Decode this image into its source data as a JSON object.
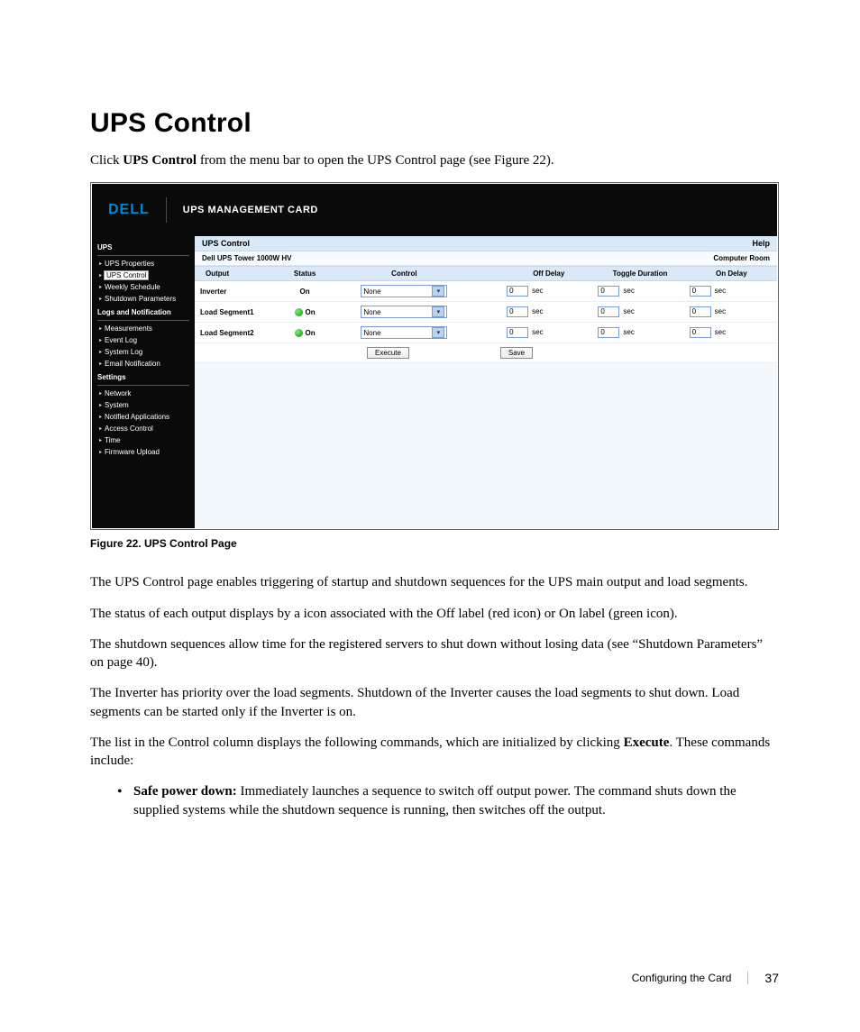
{
  "heading": "UPS Control",
  "intro_prefix": "Click ",
  "intro_bold": "UPS Control",
  "intro_suffix": " from the menu bar to open the UPS Control page (see Figure 22).",
  "figure_caption": "Figure 22. UPS Control Page",
  "shot": {
    "logo": "DELL",
    "card_name": "UPS MANAGEMENT CARD",
    "sidebar": {
      "sections": [
        {
          "title": "UPS",
          "items": [
            {
              "label": "UPS Properties",
              "selected": false
            },
            {
              "label": "UPS Control",
              "selected": true
            },
            {
              "label": "Weekly Schedule",
              "selected": false
            },
            {
              "label": "Shutdown Parameters",
              "selected": false
            }
          ]
        },
        {
          "title": "Logs and Notification",
          "items": [
            {
              "label": "Measurements"
            },
            {
              "label": "Event Log"
            },
            {
              "label": "System Log"
            },
            {
              "label": "Email Notification"
            }
          ]
        },
        {
          "title": "Settings",
          "items": [
            {
              "label": "Network"
            },
            {
              "label": "System"
            },
            {
              "label": "Notified Applications"
            },
            {
              "label": "Access Control"
            },
            {
              "label": "Time"
            },
            {
              "label": "Firmware Upload"
            }
          ]
        }
      ]
    },
    "titlebar": {
      "left": "UPS Control",
      "right": "Help"
    },
    "hostbar": {
      "left": "Dell UPS Tower 1000W HV",
      "right": "Computer Room"
    },
    "table": {
      "headers": [
        "Output",
        "Status",
        "Control",
        "Off Delay",
        "Toggle Duration",
        "On Delay"
      ],
      "unit": "sec",
      "rows": [
        {
          "output": "Inverter",
          "status_on": true,
          "status_label": "On",
          "control": "None",
          "off": "0",
          "toggle": "0",
          "on": "0",
          "show_dot": false
        },
        {
          "output": "Load Segment1",
          "status_on": true,
          "status_label": "On",
          "control": "None",
          "off": "0",
          "toggle": "0",
          "on": "0",
          "show_dot": true
        },
        {
          "output": "Load Segment2",
          "status_on": true,
          "status_label": "On",
          "control": "None",
          "off": "0",
          "toggle": "0",
          "on": "0",
          "show_dot": true
        }
      ],
      "execute_label": "Execute",
      "save_label": "Save"
    }
  },
  "paragraphs": {
    "p1": "The UPS Control page enables triggering of startup and shutdown sequences for the UPS main output and load segments.",
    "p2": "The status of each output displays by a icon associated with the Off label (red icon) or On label (green icon).",
    "p3": "The shutdown sequences allow time for the registered servers to shut down without losing data (see “Shutdown Parameters” on page 40).",
    "p4": "The Inverter has priority over the load segments. Shutdown of the Inverter causes the load segments to shut down. Load segments can be started only if the Inverter is on.",
    "p5_a": "The list in the Control column displays the following commands, which are initialized by clicking ",
    "p5_bold": "Execute",
    "p5_b": ". These commands include:"
  },
  "bullet": {
    "lead_bold": "Safe power down:",
    "rest": " Immediately launches a sequence to switch off output power. The command shuts down the supplied systems while the shutdown sequence is running, then switches off the output."
  },
  "footer": {
    "section": "Configuring the Card",
    "page": "37"
  }
}
